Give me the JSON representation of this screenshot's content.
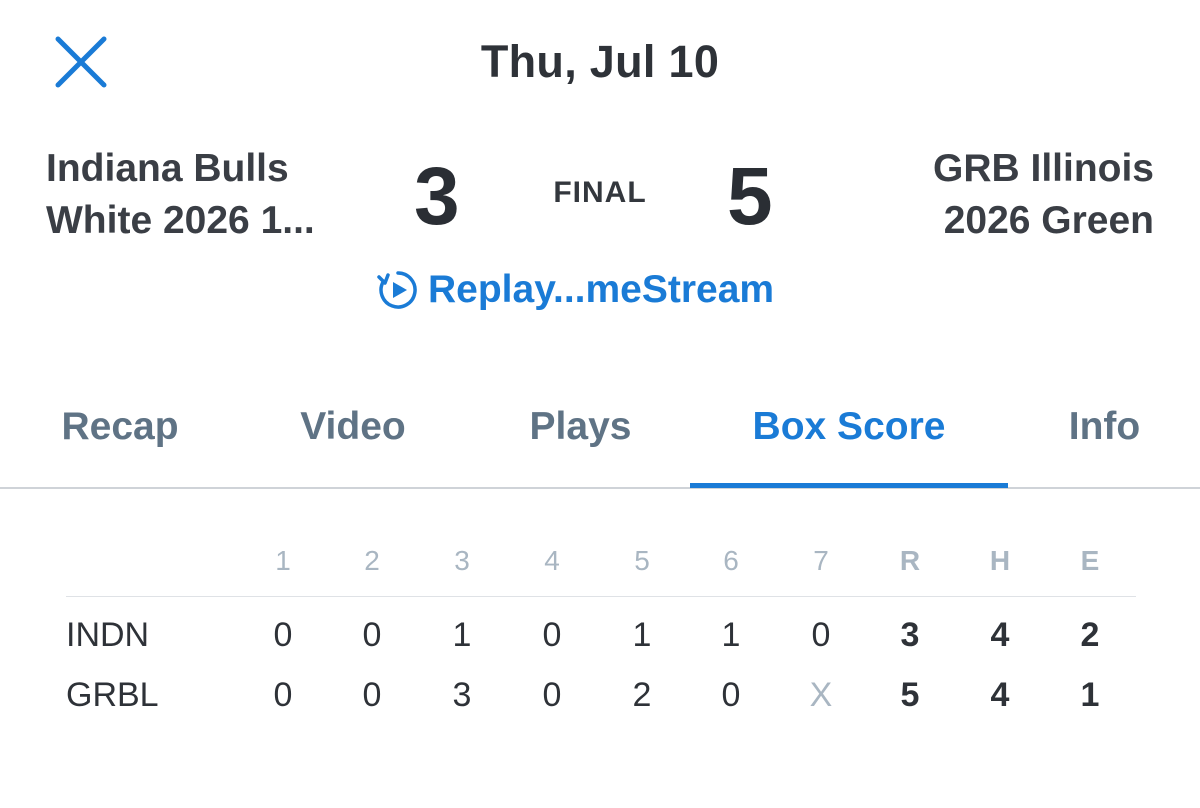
{
  "header": {
    "date": "Thu, Jul 10",
    "close_icon": "close-icon"
  },
  "game": {
    "away_team": {
      "line1": "Indiana Bulls",
      "line2": "White 2026 1..."
    },
    "home_team": {
      "line1": "GRB Illinois",
      "line2": "2026 Green"
    },
    "away_score": "3",
    "home_score": "5",
    "status": "FINAL"
  },
  "replay": {
    "label": "Replay...meStream",
    "icon": "replay-play-icon"
  },
  "tabs": [
    {
      "label": "Recap",
      "active": false
    },
    {
      "label": "Video",
      "active": false
    },
    {
      "label": "Plays",
      "active": false
    },
    {
      "label": "Box Score",
      "active": true
    },
    {
      "label": "Info",
      "active": false
    }
  ],
  "box_score": {
    "innings": [
      "1",
      "2",
      "3",
      "4",
      "5",
      "6",
      "7"
    ],
    "totals": [
      "R",
      "H",
      "E"
    ],
    "rows": [
      {
        "team": "INDN",
        "innings": [
          "0",
          "0",
          "1",
          "0",
          "1",
          "1",
          "0"
        ],
        "totals": [
          "3",
          "4",
          "2"
        ]
      },
      {
        "team": "GRBL",
        "innings": [
          "0",
          "0",
          "3",
          "0",
          "2",
          "0",
          "X"
        ],
        "totals": [
          "5",
          "4",
          "1"
        ]
      }
    ]
  },
  "colors": {
    "accent": "#1a7bd6",
    "text": "#2e3238",
    "muted": "#a9b6c2",
    "tab_inactive": "#5f7385"
  }
}
